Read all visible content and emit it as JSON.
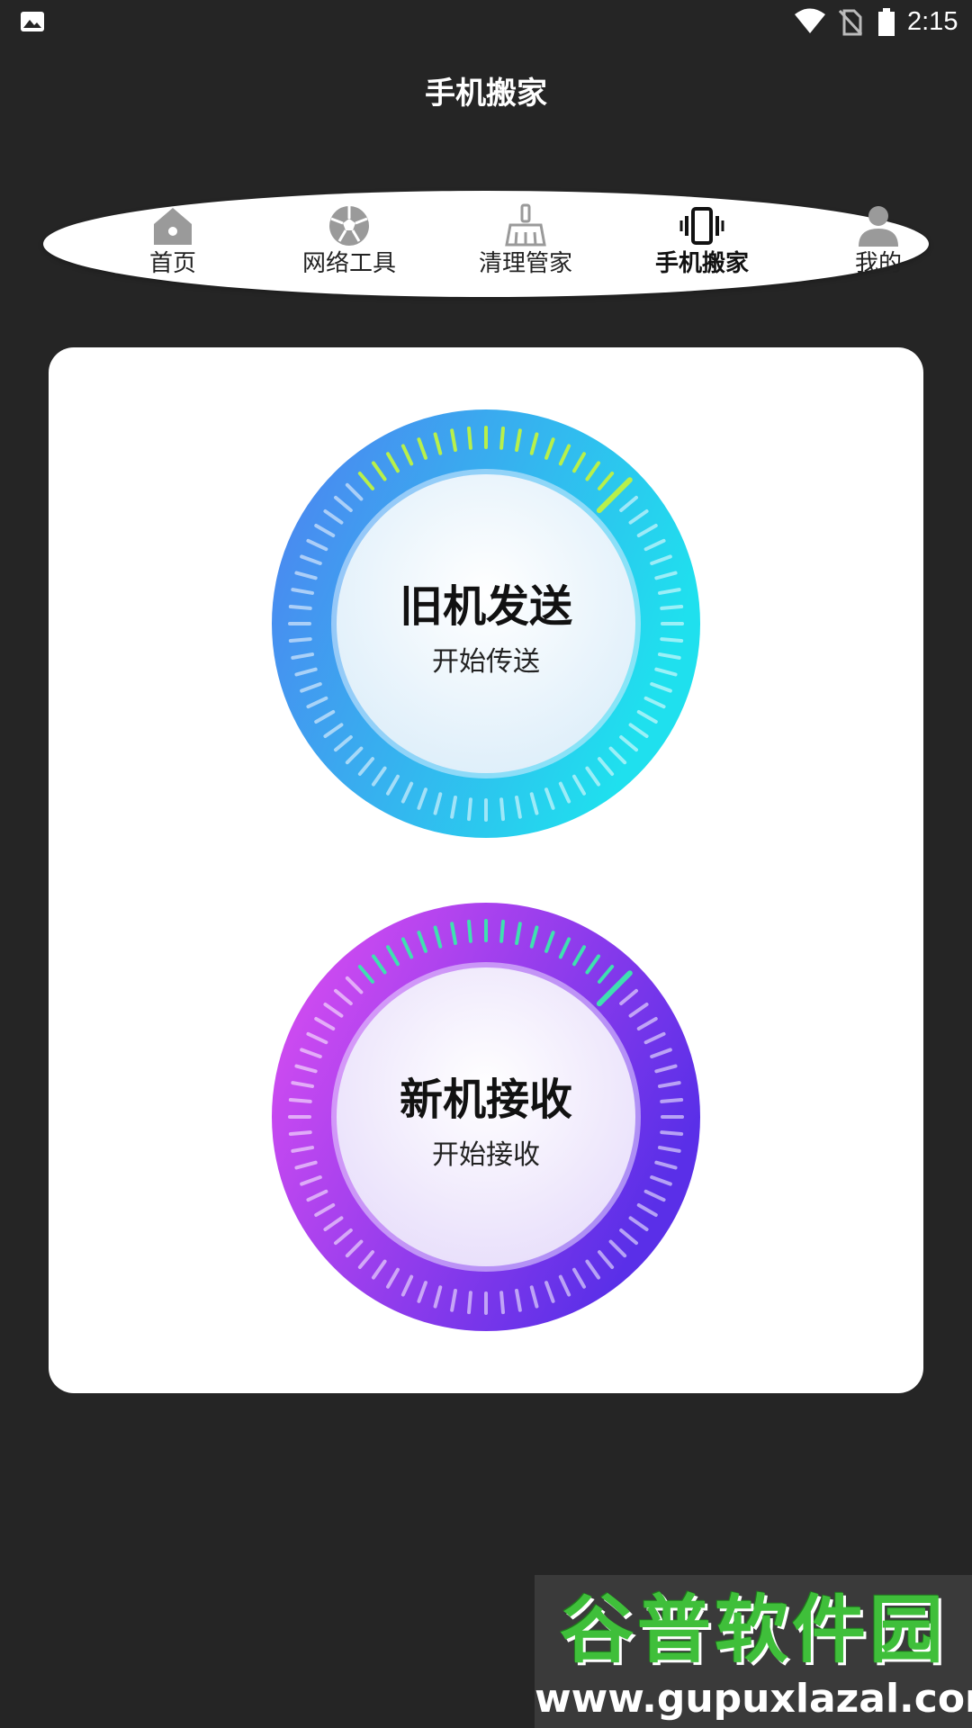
{
  "status_bar": {
    "time": "2:15",
    "icons": [
      "photo-icon",
      "wifi-icon",
      "no-sim-icon",
      "battery-icon"
    ]
  },
  "app": {
    "title": "手机搬家"
  },
  "nav": {
    "items": [
      {
        "label": "首页",
        "icon": "home-icon",
        "active": false
      },
      {
        "label": "网络工具",
        "icon": "network-ball-icon",
        "active": false
      },
      {
        "label": "清理管家",
        "icon": "broom-icon",
        "active": false
      },
      {
        "label": "手机搬家",
        "icon": "phone-vibrate-icon",
        "active": true
      },
      {
        "label": "我的",
        "icon": "user-icon",
        "active": false
      }
    ]
  },
  "main": {
    "send": {
      "title": "旧机发送",
      "subtitle": "开始传送",
      "colors": {
        "from": "#4f7ff0",
        "to": "#1fe0ee",
        "tick_highlight": "#b8f04a"
      }
    },
    "receive": {
      "title": "新机接收",
      "subtitle": "开始接收",
      "colors": {
        "from": "#e04ff2",
        "to": "#5a2fe8",
        "tick_highlight": "#3fe0b0"
      }
    }
  },
  "watermark": {
    "logo_text": "谷普软件园",
    "url": "www.gupuxlazal.com"
  },
  "colors": {
    "background": "#252525",
    "card": "#ffffff",
    "nav_icon": "#9a9a9a",
    "nav_icon_active": "#111111"
  }
}
